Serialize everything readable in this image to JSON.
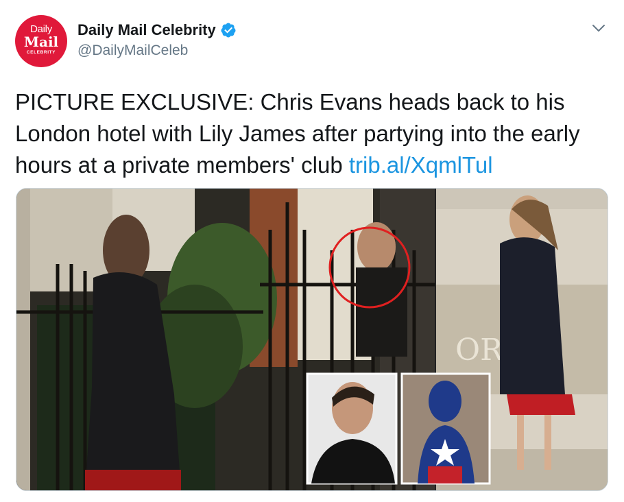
{
  "account": {
    "avatar": {
      "line1": "Daily",
      "line2": "Mail",
      "line3": "CELEBRITY"
    },
    "display_name": "Daily Mail Celebrity",
    "handle": "@DailyMailCeleb",
    "verified": true
  },
  "tweet": {
    "text": "PICTURE EXCLUSIVE: Chris Evans heads back to his London hotel with Lily James after partying into the early hours at a private members' club ",
    "link": "trib.al/XqmlTul"
  },
  "media": {
    "sign_letters": "OR   HI"
  },
  "icons": {
    "verified": "verified-badge-icon",
    "menu": "chevron-down-icon"
  },
  "colors": {
    "brand_red": "#e0193a",
    "link_blue": "#1b95e0",
    "verified_blue": "#1da1f2",
    "handle_gray": "#657786"
  }
}
